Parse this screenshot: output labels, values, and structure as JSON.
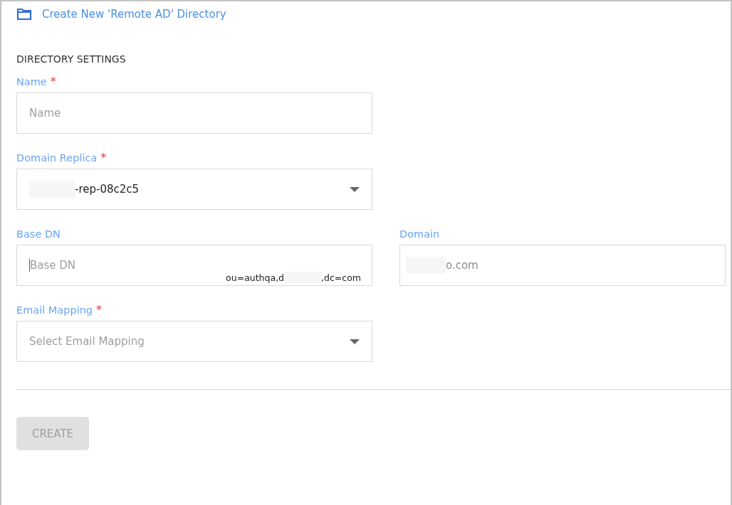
{
  "header": {
    "title": "Create New 'Remote AD' Directory"
  },
  "section": {
    "title": "DIRECTORY SETTINGS"
  },
  "rows": [
    [
      {
        "kind": "text",
        "label": "Name",
        "required_mark": "*",
        "placeholder": "Name"
      }
    ],
    [
      {
        "kind": "select",
        "label": "Domain Replica",
        "required_mark": "*",
        "value": "-rep-08c2c5",
        "redacted": true
      }
    ],
    [
      {
        "kind": "text",
        "label": "Base DN",
        "placeholder": "Base DN",
        "focused": true,
        "hint_parts": [
          "ou=authqa,d",
          ",dc=com"
        ]
      },
      {
        "kind": "readonly",
        "label": "Domain",
        "value": "o.com",
        "redacted": true
      }
    ],
    [
      {
        "kind": "select",
        "label": "Email Mapping",
        "required_mark": "*",
        "placeholder": "Select Email Mapping"
      }
    ]
  ],
  "buttons": [
    {
      "label": "CREATE",
      "disabled": true
    }
  ]
}
